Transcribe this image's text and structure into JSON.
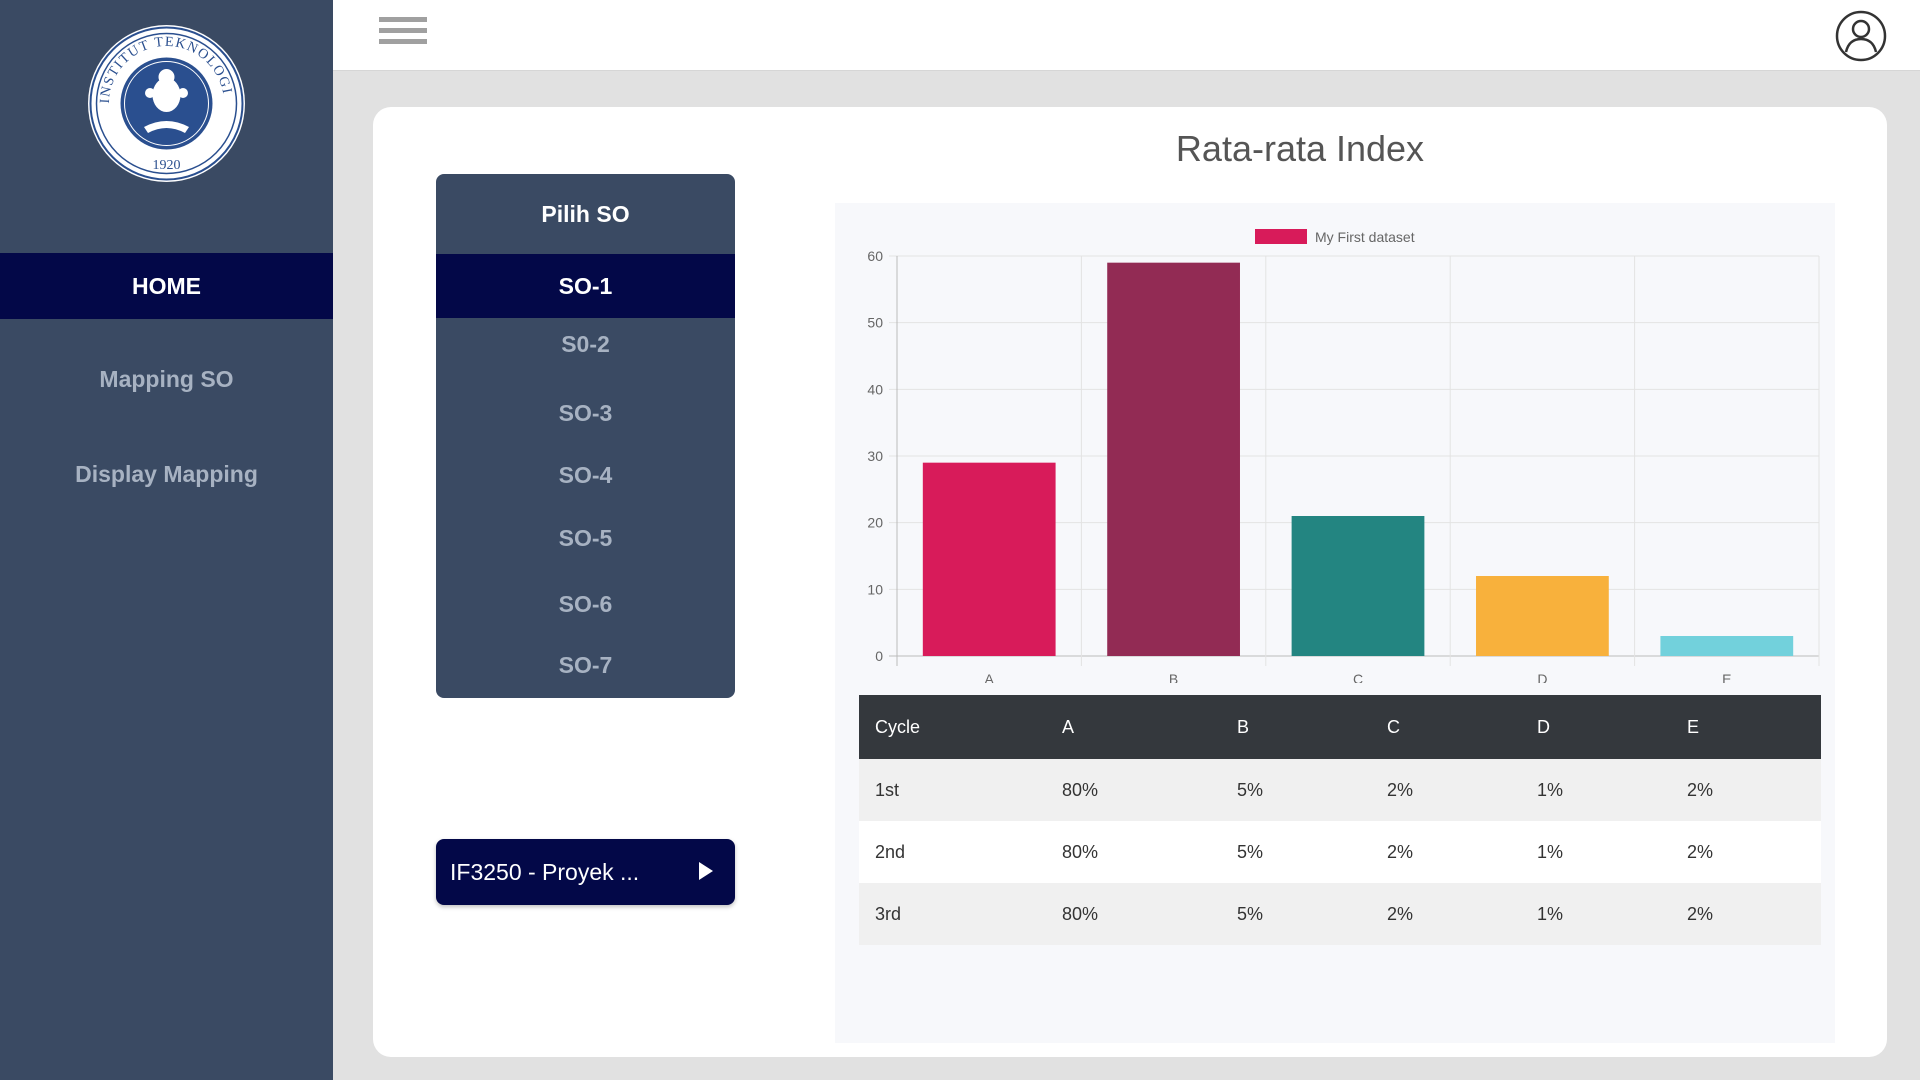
{
  "sidebar": {
    "logo_text": "INSTITUT TEKNOLOGI BANDUNG",
    "logo_year": "1920",
    "items": [
      {
        "label": "HOME",
        "active": true
      },
      {
        "label": "Mapping SO",
        "active": false
      },
      {
        "label": "Display Mapping",
        "active": false
      }
    ]
  },
  "topbar": {
    "menu_icon": "hamburger-icon",
    "user_icon": "user-icon"
  },
  "so_panel": {
    "header": "Pilih SO",
    "items": [
      "SO-1",
      "S0-2",
      "SO-3",
      "SO-4",
      "SO-5",
      "SO-6",
      "SO-7"
    ],
    "selected": "SO-1"
  },
  "course_button": {
    "label": "IF3250 - Proyek ...",
    "icon": "play-icon"
  },
  "main": {
    "title": "Rata-rata Index"
  },
  "chart_data": {
    "type": "bar",
    "categories": [
      "A",
      "B",
      "C",
      "D",
      "E"
    ],
    "series": [
      {
        "name": "My First dataset",
        "values": [
          29,
          59,
          21,
          12,
          3
        ]
      }
    ],
    "bar_colors": [
      "#d81b5a",
      "#922b54",
      "#238581",
      "#f8b13c",
      "#72d1dc"
    ],
    "legend_color": "#d81b5a",
    "ylim": [
      0,
      60
    ],
    "yticks": [
      0,
      10,
      20,
      30,
      40,
      50,
      60
    ],
    "grid": true,
    "legend_position": "top"
  },
  "table": {
    "headers": [
      "Cycle",
      "A",
      "B",
      "C",
      "D",
      "E"
    ],
    "rows": [
      [
        "1st",
        "80%",
        "5%",
        "2%",
        "1%",
        "2%"
      ],
      [
        "2nd",
        "80%",
        "5%",
        "2%",
        "1%",
        "2%"
      ],
      [
        "3rd",
        "80%",
        "5%",
        "2%",
        "1%",
        "2%"
      ]
    ]
  }
}
